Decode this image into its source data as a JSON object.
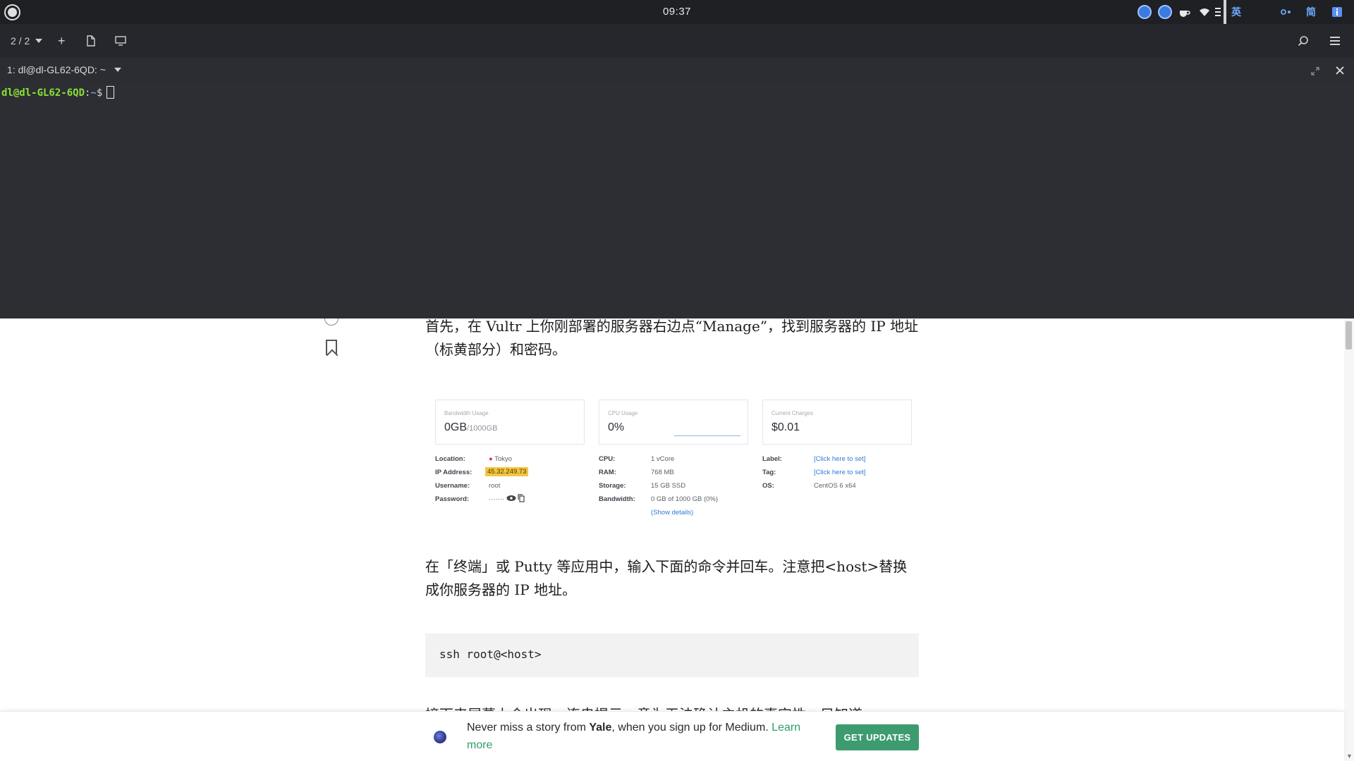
{
  "system_bar": {
    "clock": "09:37",
    "tray": {
      "input_lang": "英",
      "input_mode": "简"
    }
  },
  "terminal": {
    "toolbar": {
      "tab_counter": "2 / 2",
      "add_label": "+"
    },
    "tab_title": "1: dl@dl-GL62-6QD: ~",
    "prompt": {
      "user_host": "dl@dl-GL62-6QD",
      "separator": ":",
      "path": "~",
      "symbol": "$"
    }
  },
  "article": {
    "para1": "首先，在 Vultr 上你刚部署的服务器右边点“Manage”，找到服务器的 IP 地址（标黄部分）和密码。",
    "vultr": {
      "cards": [
        {
          "title": "Bandwidth Usage",
          "value": "0GB",
          "sub": "/1000GB"
        },
        {
          "title": "CPU Usage",
          "value": "0%"
        },
        {
          "title": "Current Charges",
          "value": "$0.01"
        }
      ],
      "col1": {
        "location_label": "Location:",
        "location_value": "Tokyo",
        "ip_label": "IP Address:",
        "ip_value": "45.32.249.73",
        "username_label": "Username:",
        "username_value": "root",
        "password_label": "Password:",
        "password_value": "·······"
      },
      "col2": {
        "cpu_label": "CPU:",
        "cpu_value": "1 vCore",
        "ram_label": "RAM:",
        "ram_value": "768 MB",
        "storage_label": "Storage:",
        "storage_value": "15 GB SSD",
        "bandwidth_label": "Bandwidth:",
        "bandwidth_value": "0 GB of 1000 GB (0%)",
        "show_details": "(Show details)"
      },
      "col3": {
        "label_label": "Label:",
        "label_value": "[Click here to set]",
        "tag_label": "Tag:",
        "tag_value": "[Click here to set]",
        "os_label": "OS:",
        "os_value": "CentOS 6 x64"
      }
    },
    "para2": "在「终端」或 Putty 等应用中，输入下面的命令并回车。注意把<host>替换成你服务器的 IP 地址。",
    "code": "ssh root@<host>",
    "para3_partial": "接下来屏幕上会出现一连串提示，意为无法确认主机的真实性，只知道"
  },
  "banner": {
    "text_before": "Never miss a story from ",
    "publication": "Yale",
    "text_after": ", when you sign up for Medium. ",
    "learn_more": "Learn more",
    "button": "GET UPDATES"
  }
}
